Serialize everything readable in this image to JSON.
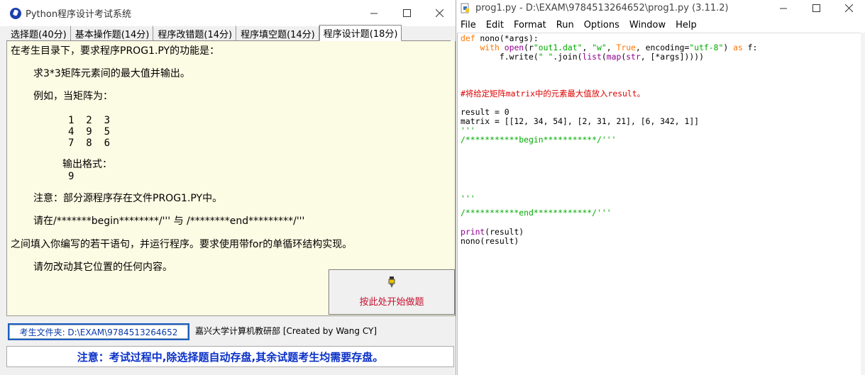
{
  "left_window": {
    "title": "Python程序设计考试系统",
    "tabs": [
      "选择题(40分)",
      "基本操作题(14分)",
      "程序改错题(14分)",
      "程序填空题(14分)",
      "程序设计题(18分)"
    ],
    "active_tab": 4,
    "content": {
      "line1": "在考生目录下，要求程序PROG1.PY的功能是：",
      "line2": "求3*3矩阵元素间的最大值并输出。",
      "line3": "例如，当矩阵为：",
      "matrix_row1": "1  2  3",
      "matrix_row2": "4  9  5",
      "matrix_row3": "7  8  6",
      "output_label": "输出格式：",
      "output_value": "9",
      "note": "注意：部分源程序存在文件PROG1.PY中。",
      "instruction": "请在/*******begin********/''' 与 /********end*********/'''",
      "instruction2": "之间填入你编写的若干语句，并运行程序。要求使用带for的单循环结构实现。",
      "warning": "请勿改动其它位置的任何内容。"
    },
    "start_button": "按此处开始做题",
    "status": {
      "path_label": "考生文件夹: D:\\EXAM\\9784513264652",
      "credit": "嘉兴大学计算机教研部 [Created by Wang CY]"
    },
    "notice": "注意：考试过程中,除选择题自动存盘,其余试题考生均需要存盘。"
  },
  "right_window": {
    "title": "prog1.py - D:\\EXAM\\9784513264652\\prog1.py (3.11.2)",
    "menu": [
      "File",
      "Edit",
      "Format",
      "Run",
      "Options",
      "Window",
      "Help"
    ],
    "code_lines": [
      "def nono(*args):",
      "    with open(r\"out1.dat\", \"w\", True, encoding=\"utf-8\") as f:",
      "        f.write(\" \".join(list(map(str, [*args]))))",
      "#将给定矩阵matrix中的元素最大值放入result。",
      "result = 0",
      "matrix = [[12, 34, 54], [2, 31, 21], [6, 342, 1]]",
      "'''",
      "/***********begin***********/'''",
      "'''",
      "/***********end************/'''",
      "print(result)",
      "nono(result)"
    ]
  },
  "colors": {
    "keyword": "#ff7700",
    "builtin": "#900090",
    "string": "#00aa00",
    "comment": "#dd0000",
    "notice_text": "#0a30c8",
    "start_label": "#c8102e",
    "content_bg": "#fcfbe3"
  }
}
